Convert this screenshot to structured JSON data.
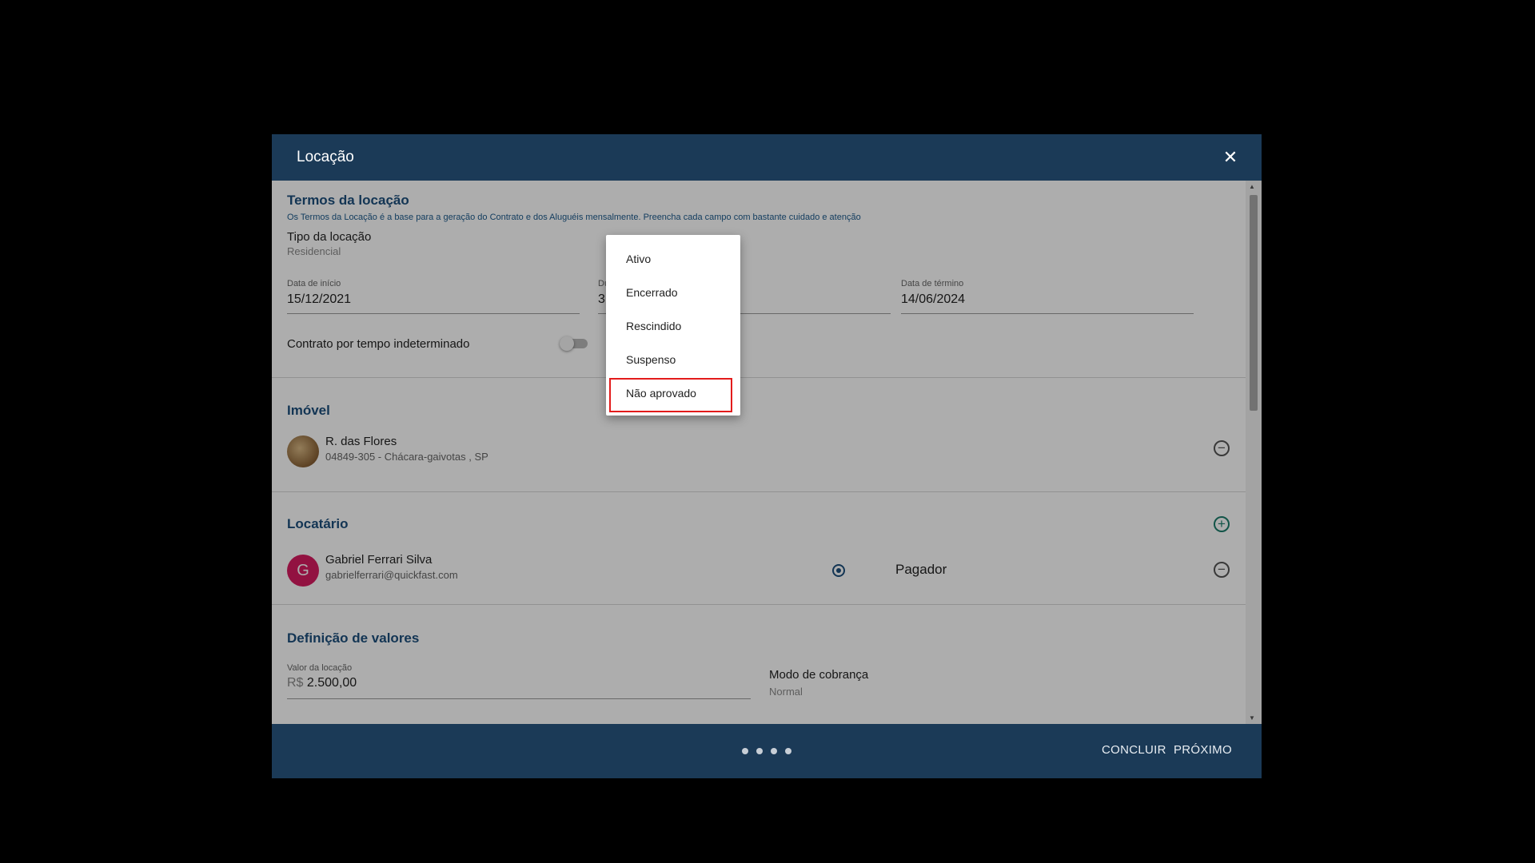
{
  "dialog": {
    "title": "Locação"
  },
  "terms": {
    "title": "Termos da locação",
    "subtitle": "Os Termos da Locação é a base para a geração do Contrato e dos Aluguéis mensalmente. Preencha cada campo com bastante cuidado e atenção",
    "tipo_label": "Tipo da locação",
    "tipo_value": "Residencial",
    "inicio_label": "Data de início",
    "inicio_value": "15/12/2021",
    "duracao_label": "Du",
    "duracao_value": "3",
    "termino_label": "Data de término",
    "termino_value": "14/06/2024",
    "indeterminado_label": "Contrato por tempo indeterminado"
  },
  "imovel": {
    "title": "Imóvel",
    "name": "R. das Flores",
    "address": "04849-305 - Chácara-gaivotas , SP"
  },
  "locatario": {
    "title": "Locatário",
    "avatar_letter": "G",
    "name": "Gabriel Ferrari Silva",
    "email": "gabrielferrari@quickfast.com",
    "role_label": "Pagador"
  },
  "valores": {
    "title": "Definição de valores",
    "valor_label": "Valor da locação",
    "currency": "R$",
    "valor_value": "2.500,00",
    "modo_label": "Modo de cobrança",
    "modo_value": "Normal"
  },
  "status_menu": {
    "items": [
      "Ativo",
      "Encerrado",
      "Rescindido",
      "Suspenso",
      "Não aprovado"
    ],
    "highlighted": "Não aprovado"
  },
  "footer": {
    "concluir": "CONCLUIR",
    "proximo": "PRÓXIMO",
    "step_count": 4,
    "active_step": 1
  },
  "colors": {
    "header_bg": "#1b3a57",
    "section_title": "#1c4f7c",
    "avatar_bg": "#d81b60",
    "add_icon": "#1b7d6a",
    "highlight_border": "#e31b1b"
  },
  "icons": [
    "close-icon",
    "remove-icon",
    "add-icon",
    "radio-selected-icon",
    "scroll-up-icon",
    "scroll-down-icon"
  ]
}
